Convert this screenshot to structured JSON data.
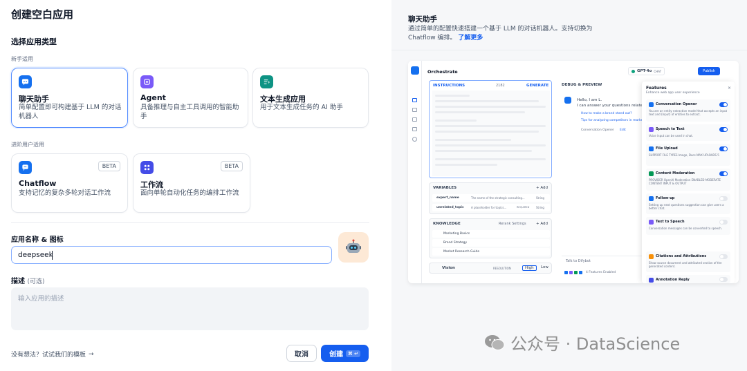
{
  "dialog": {
    "title": "创建空白应用",
    "section_type": "选择应用类型",
    "group_beginner": "新手适用",
    "group_advanced": "进阶用户适用",
    "cards": [
      {
        "title": "聊天助手",
        "desc": "简单配置即可构建基于 LLM 的对话机器人",
        "icon": "chat-bubble-icon",
        "color": "#1570ef"
      },
      {
        "title": "Agent",
        "desc": "具备推理与自主工具调用的智能助手",
        "icon": "agent-icon",
        "color": "#7a5af8"
      },
      {
        "title": "文本生成应用",
        "desc": "用于文本生成任务的 AI 助手",
        "icon": "text-generate-icon",
        "color": "#0e9384"
      },
      {
        "title": "Chatflow",
        "desc": "支持记忆的复杂多轮对话工作流",
        "icon": "chatflow-icon",
        "color": "#1570ef",
        "badge": "BETA"
      },
      {
        "title": "工作流",
        "desc": "面向单轮自动化任务的编排工作流",
        "icon": "workflow-icon",
        "color": "#444ce7",
        "badge": "BETA"
      }
    ],
    "name_label": "应用名称 & 图标",
    "name_value": "deepseek",
    "desc_label": "描述",
    "desc_optional": "(可选)",
    "desc_placeholder": "输入应用的描述",
    "template_hint": "没有想法？试试我们的模板",
    "cancel_label": "取消",
    "create_label": "创建",
    "create_shortcut": "⌘ ↵"
  },
  "preview": {
    "title": "聊天助手",
    "desc": "通过简单的配置快速搭建一个基于 LLM 的对话机器人。支持切换为 Chatflow 编排。",
    "learn_more": "了解更多",
    "mock": {
      "orchestrate": "Orchestrate",
      "model": "GPT-4o",
      "model_mode": "CHAT",
      "publish": "Publish",
      "instructions": "INSTRUCTIONS",
      "char_count": "2182",
      "generate": "GENERATE",
      "variables": "VARIABLES",
      "add": "+ Add",
      "var_rows": [
        {
          "key": "expert_name",
          "desc": "The name of the strategic consulting...",
          "type": "String"
        },
        {
          "key": "unrelated_topic",
          "desc": "A placeholder for topics...",
          "type": "String",
          "required": "REQUIRED"
        }
      ],
      "knowledge": "KNOWLEDGE",
      "rerank": "Rerank Settings",
      "knowledge_rows": [
        "Marketing Basics",
        "Brand Strategy",
        "Market Research Guide"
      ],
      "vision": "Vision",
      "resolution": "RESOLUTION",
      "high": "High",
      "low": "Low",
      "debug": "DEBUG & PREVIEW",
      "hello": "Hello, I am L.",
      "hello2": "I can answer your questions related",
      "sugg1": "How to make a brand stand out?",
      "sugg2": "Tips for analyzing competitors in market",
      "opener": "Conversation Opener",
      "edit": "Edit",
      "talk": "Talk to Difybot",
      "features_enabled": "4 Features Enabled",
      "features_title": "Features",
      "features_sub": "Enhance web app user experience",
      "features": [
        {
          "name": "Conversation Opener",
          "desc": "You are an entity extraction model that accepts an input text and (Input) of entities to extract.",
          "on": true,
          "color": "#1570ef"
        },
        {
          "name": "Speech to Text",
          "desc": "Voice input can be used in chat.",
          "on": true,
          "color": "#7a5af8"
        },
        {
          "name": "File Upload",
          "desc": "SUPPORT FILE TYPES  Image, Docs    MAX UPLOADS  5",
          "on": true,
          "color": "#1570ef"
        },
        {
          "name": "Content Moderation",
          "desc": "PROVIDER  OpenAI Moderation    ENABLED MODERATE CONTENT  INPUT & OUTPUT",
          "on": true,
          "color": "#039855"
        },
        {
          "name": "Follow-up",
          "desc": "Setting up next questions suggestion can give users a better chat.",
          "on": false,
          "color": "#1570ef"
        },
        {
          "name": "Text to Speech",
          "desc": "Conversation messages can be converted to speech.",
          "on": false,
          "color": "#7a5af8"
        },
        {
          "name": "Citations and Attributions",
          "desc": "Show source document and attributed section of the generated content.",
          "on": false,
          "color": "#f79009"
        },
        {
          "name": "Annotation Reply",
          "desc": "",
          "on": false,
          "color": "#444ce7"
        }
      ]
    }
  },
  "watermark": "公众号 · DataScience"
}
